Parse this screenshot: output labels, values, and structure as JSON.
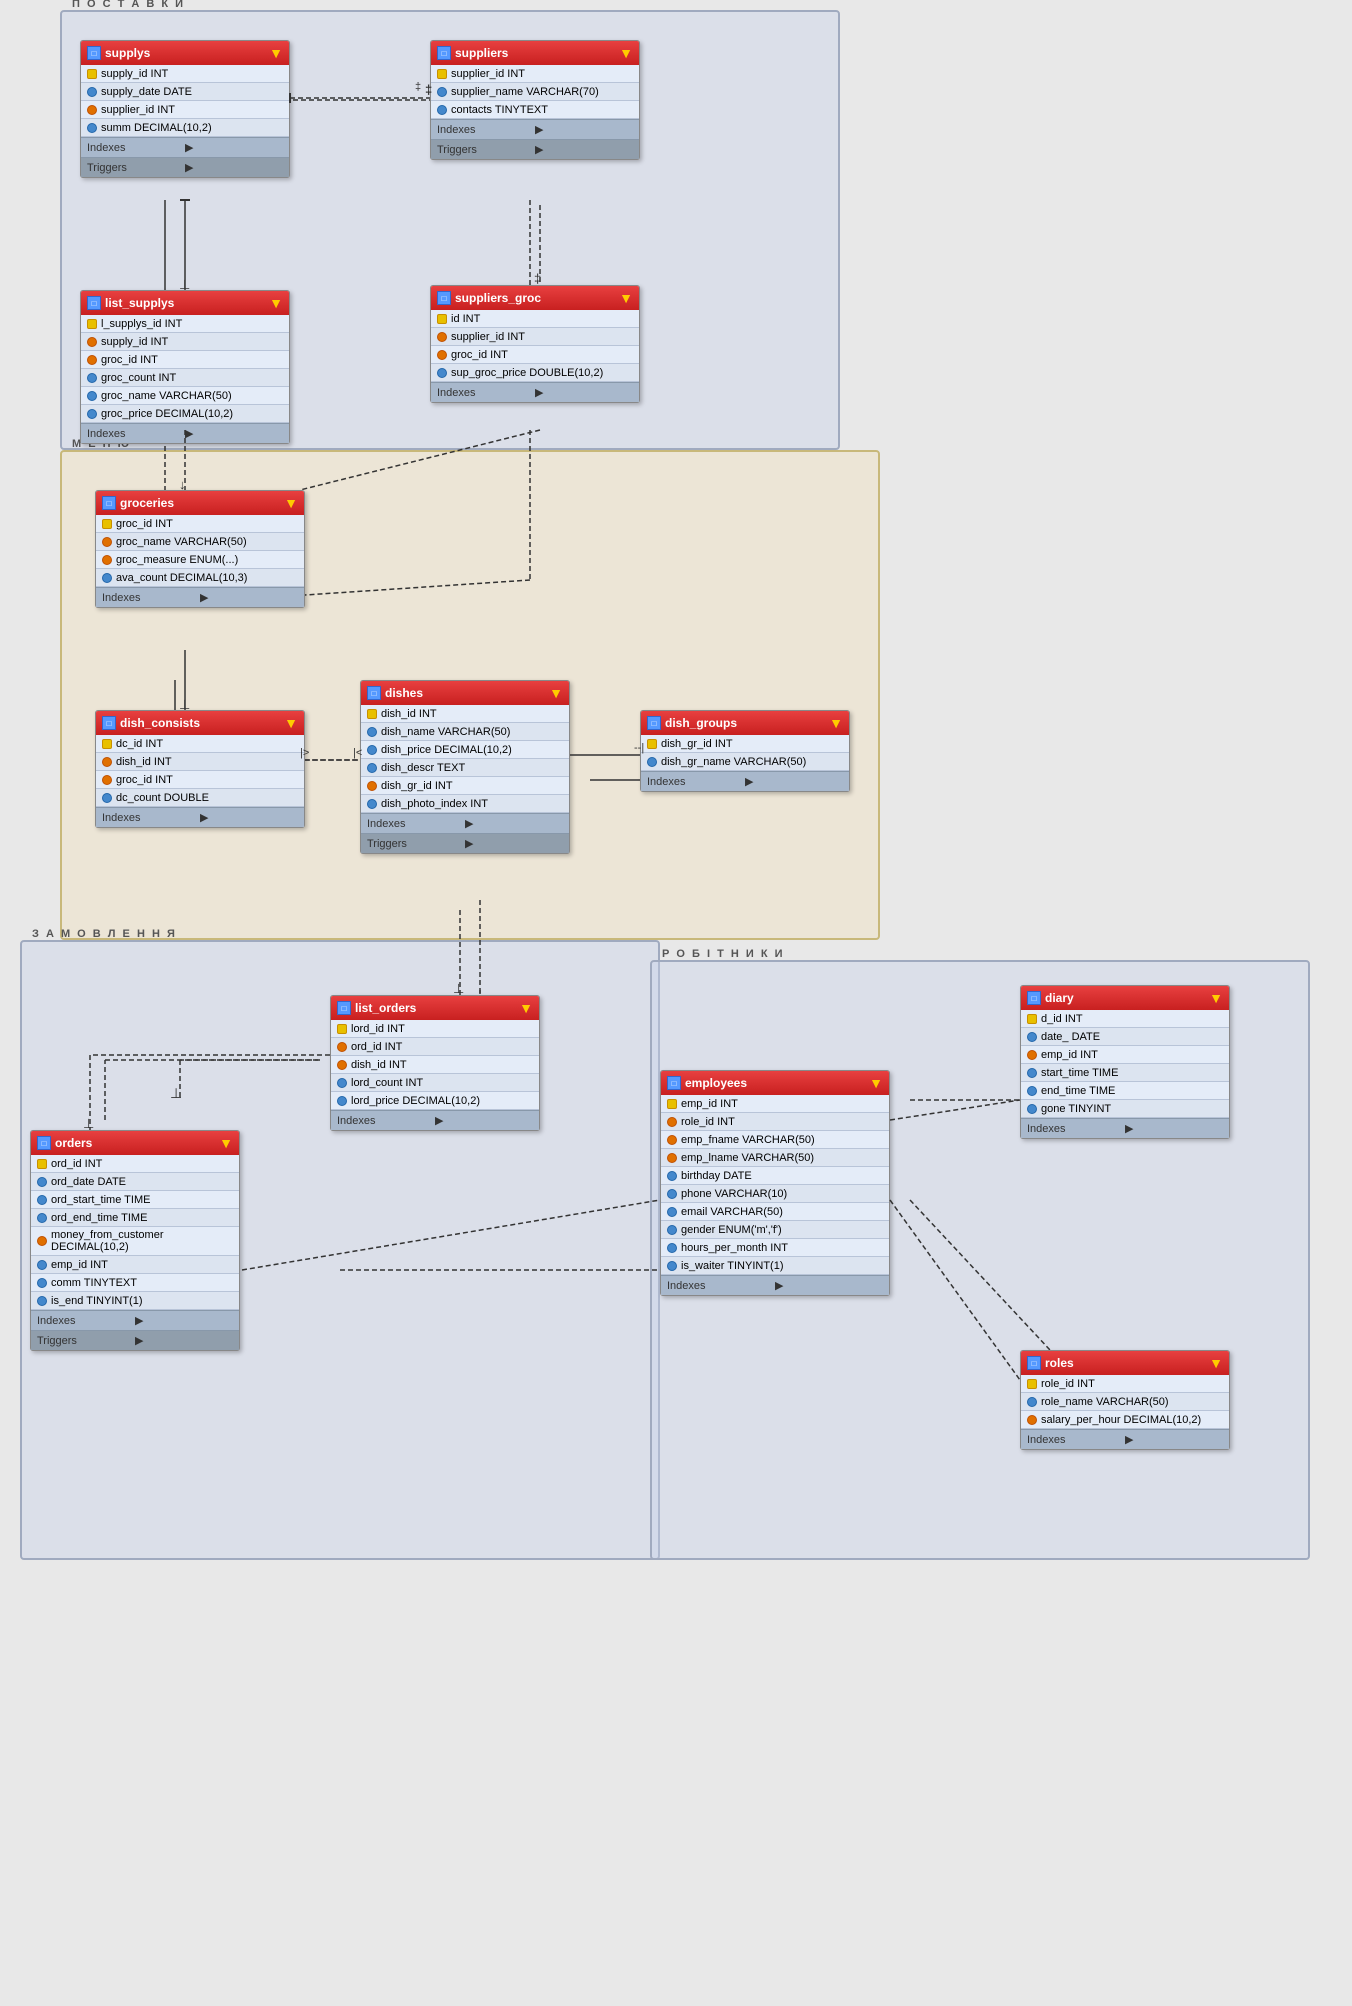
{
  "groups": {
    "postaky": {
      "label": "П О С Т А В К И"
    },
    "menu": {
      "label": "М Е Н Ю"
    },
    "zamovlennya": {
      "label": "З А М О В Л Е Н Н Я"
    },
    "robitnyky": {
      "label": "Р О Б І Т Н И К И"
    }
  },
  "tables": {
    "supplys": {
      "name": "supplys",
      "fields": [
        {
          "name": "supply_id INT",
          "type": "key"
        },
        {
          "name": "supply_date DATE",
          "type": "field"
        },
        {
          "name": "supplier_id INT",
          "type": "fk"
        },
        {
          "name": "summ DECIMAL(10,2)",
          "type": "field"
        }
      ],
      "footers": [
        "Indexes",
        "Triggers"
      ]
    },
    "suppliers": {
      "name": "suppliers",
      "fields": [
        {
          "name": "supplier_id INT",
          "type": "key"
        },
        {
          "name": "supplier_name VARCHAR(70)",
          "type": "field"
        },
        {
          "name": "contacts TINYTEXT",
          "type": "field"
        }
      ],
      "footers": [
        "Indexes",
        "Triggers"
      ]
    },
    "list_supplys": {
      "name": "list_supplys",
      "fields": [
        {
          "name": "l_supplys_id INT",
          "type": "key"
        },
        {
          "name": "supply_id INT",
          "type": "fk"
        },
        {
          "name": "groc_id INT",
          "type": "fk"
        },
        {
          "name": "groc_count INT",
          "type": "field"
        },
        {
          "name": "groc_name VARCHAR(50)",
          "type": "field"
        },
        {
          "name": "groc_price DECIMAL(10,2)",
          "type": "field"
        }
      ],
      "footers": [
        "Indexes"
      ]
    },
    "suppliers_groc": {
      "name": "suppliers_groc",
      "fields": [
        {
          "name": "id INT",
          "type": "key"
        },
        {
          "name": "supplier_id INT",
          "type": "fk"
        },
        {
          "name": "groc_id INT",
          "type": "fk"
        },
        {
          "name": "sup_groc_price DOUBLE(10,2)",
          "type": "field"
        }
      ],
      "footers": [
        "Indexes"
      ]
    },
    "groceries": {
      "name": "groceries",
      "fields": [
        {
          "name": "groc_id INT",
          "type": "key"
        },
        {
          "name": "groc_name VARCHAR(50)",
          "type": "fk"
        },
        {
          "name": "groc_measure ENUM(...)",
          "type": "fk"
        },
        {
          "name": "ava_count DECIMAL(10,3)",
          "type": "field"
        }
      ],
      "footers": [
        "Indexes"
      ]
    },
    "dish_consists": {
      "name": "dish_consists",
      "fields": [
        {
          "name": "dc_id INT",
          "type": "key"
        },
        {
          "name": "dish_id INT",
          "type": "fk"
        },
        {
          "name": "groc_id INT",
          "type": "fk"
        },
        {
          "name": "dc_count DOUBLE",
          "type": "field"
        }
      ],
      "footers": [
        "Indexes"
      ]
    },
    "dishes": {
      "name": "dishes",
      "fields": [
        {
          "name": "dish_id INT",
          "type": "key"
        },
        {
          "name": "dish_name VARCHAR(50)",
          "type": "field"
        },
        {
          "name": "dish_price DECIMAL(10,2)",
          "type": "field"
        },
        {
          "name": "dish_descr TEXT",
          "type": "field"
        },
        {
          "name": "dish_gr_id INT",
          "type": "fk"
        },
        {
          "name": "dish_photo_index INT",
          "type": "field"
        }
      ],
      "footers": [
        "Indexes",
        "Triggers"
      ]
    },
    "dish_groups": {
      "name": "dish_groups",
      "fields": [
        {
          "name": "dish_gr_id INT",
          "type": "key"
        },
        {
          "name": "dish_gr_name VARCHAR(50)",
          "type": "field"
        }
      ],
      "footers": [
        "Indexes"
      ]
    },
    "list_orders": {
      "name": "list_orders",
      "fields": [
        {
          "name": "lord_id INT",
          "type": "key"
        },
        {
          "name": "ord_id INT",
          "type": "fk"
        },
        {
          "name": "dish_id INT",
          "type": "fk"
        },
        {
          "name": "lord_count INT",
          "type": "field"
        },
        {
          "name": "lord_price DECIMAL(10,2)",
          "type": "field"
        }
      ],
      "footers": [
        "Indexes"
      ]
    },
    "orders": {
      "name": "orders",
      "fields": [
        {
          "name": "ord_id INT",
          "type": "key"
        },
        {
          "name": "ord_date DATE",
          "type": "field"
        },
        {
          "name": "ord_start_time TIME",
          "type": "field"
        },
        {
          "name": "ord_end_time TIME",
          "type": "field"
        },
        {
          "name": "money_from_customer DECIMAL(10,2)",
          "type": "fk"
        },
        {
          "name": "emp_id INT",
          "type": "field"
        },
        {
          "name": "comm TINYTEXT",
          "type": "field"
        },
        {
          "name": "is_end TINYINT(1)",
          "type": "field"
        }
      ],
      "footers": [
        "Indexes",
        "Triggers"
      ]
    },
    "employees": {
      "name": "employees",
      "fields": [
        {
          "name": "emp_id INT",
          "type": "key"
        },
        {
          "name": "role_id INT",
          "type": "fk"
        },
        {
          "name": "emp_fname VARCHAR(50)",
          "type": "fk"
        },
        {
          "name": "emp_lname VARCHAR(50)",
          "type": "fk"
        },
        {
          "name": "birthday DATE",
          "type": "field"
        },
        {
          "name": "phone VARCHAR(10)",
          "type": "field"
        },
        {
          "name": "email VARCHAR(50)",
          "type": "field"
        },
        {
          "name": "gender ENUM('m','f')",
          "type": "field"
        },
        {
          "name": "hours_per_month INT",
          "type": "field"
        },
        {
          "name": "is_waiter TINYINT(1)",
          "type": "field"
        }
      ],
      "footers": [
        "Indexes"
      ]
    },
    "diary": {
      "name": "diary",
      "fields": [
        {
          "name": "d_id INT",
          "type": "key"
        },
        {
          "name": "date_ DATE",
          "type": "field"
        },
        {
          "name": "emp_id INT",
          "type": "fk"
        },
        {
          "name": "start_time TIME",
          "type": "field"
        },
        {
          "name": "end_time TIME",
          "type": "field"
        },
        {
          "name": "gone TINYINT",
          "type": "field"
        }
      ],
      "footers": [
        "Indexes"
      ]
    },
    "roles": {
      "name": "roles",
      "fields": [
        {
          "name": "role_id INT",
          "type": "key"
        },
        {
          "name": "role_name VARCHAR(50)",
          "type": "field"
        },
        {
          "name": "salary_per_hour DECIMAL(10,2)",
          "type": "fk"
        }
      ],
      "footers": [
        "Indexes"
      ]
    }
  }
}
